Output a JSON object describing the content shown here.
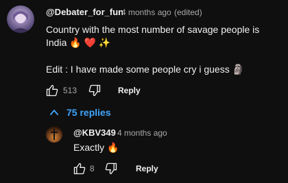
{
  "comment": {
    "author": "@Debater_for_fun",
    "time": "4 months ago",
    "edited": "(edited)",
    "line1": "Country with the most number of savage people is",
    "line2": "India 🔥 ❤️ ✨",
    "line3": "Edit : I have made some people cry i guess 🗿",
    "likes": "513",
    "reply_label": "Reply",
    "replies_toggle": "75 replies"
  },
  "reply": {
    "author": "@KBV349",
    "time": "4 months ago",
    "text": "Exactly 🔥",
    "likes": "8",
    "reply_label": "Reply"
  },
  "colors": {
    "background": "#0f0f0f",
    "text": "#f1f1f1",
    "secondary": "#aaaaaa",
    "link": "#3ea6ff"
  }
}
